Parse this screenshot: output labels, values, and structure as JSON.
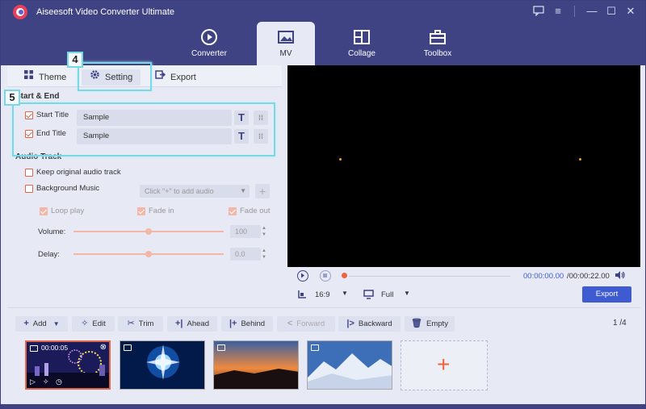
{
  "app": {
    "title": "Aiseesoft Video Converter Ultimate",
    "accent_color": "#3f4383",
    "highlight_color": "#78d9e6",
    "orange": "#e0664a"
  },
  "nav": {
    "tabs": [
      {
        "label": "Converter",
        "icon": "converter-icon",
        "active": false
      },
      {
        "label": "MV",
        "icon": "mv-image-icon",
        "active": true
      },
      {
        "label": "Collage",
        "icon": "collage-icon",
        "active": false
      },
      {
        "label": "Toolbox",
        "icon": "toolbox-icon",
        "active": false
      }
    ]
  },
  "window_controls": [
    "feedback-icon",
    "menu-icon",
    "minimize-icon",
    "maximize-icon",
    "close-icon"
  ],
  "sub_tabs": [
    {
      "label": "Theme",
      "icon": "theme-icon"
    },
    {
      "label": "Setting",
      "icon": "gear-icon"
    },
    {
      "label": "Export",
      "icon": "export-icon"
    }
  ],
  "annotations": {
    "badge4": "4",
    "badge5": "5"
  },
  "start_end": {
    "section_title": "Start & End",
    "start": {
      "label": "Start Title",
      "value": "Sample",
      "checked": true
    },
    "end": {
      "label": "End Title",
      "value": "Sample",
      "checked": true
    }
  },
  "audio": {
    "section_title": "Audio Track",
    "keep_original": {
      "label": "Keep original audio track",
      "checked": false
    },
    "background_music": {
      "label": "Background Music",
      "checked": false
    },
    "add_audio_placeholder": "Click \"+\" to add audio",
    "loop_play": "Loop play",
    "fade_in": "Fade in",
    "fade_out": "Fade out",
    "volume_label": "Volume:",
    "volume_value": "100",
    "volume_level": 0.5,
    "delay_label": "Delay:",
    "delay_value": "0.0",
    "delay_level": 0.5
  },
  "player": {
    "time_current": "00:00:00.00",
    "time_total": "/00:00:22.00",
    "aspect": "16:9",
    "zoom": "Full",
    "export_label": "Export"
  },
  "toolbar": {
    "add": "Add",
    "edit": "Edit",
    "trim": "Trim",
    "ahead": "Ahead",
    "behind": "Behind",
    "forward": "Forward",
    "backward": "Backward",
    "empty": "Empty",
    "page_current": "1",
    "page_total": "/4"
  },
  "clips": [
    {
      "duration": "00:00:05",
      "selected": true
    },
    {
      "selected": false
    },
    {
      "selected": false
    },
    {
      "selected": false
    }
  ]
}
